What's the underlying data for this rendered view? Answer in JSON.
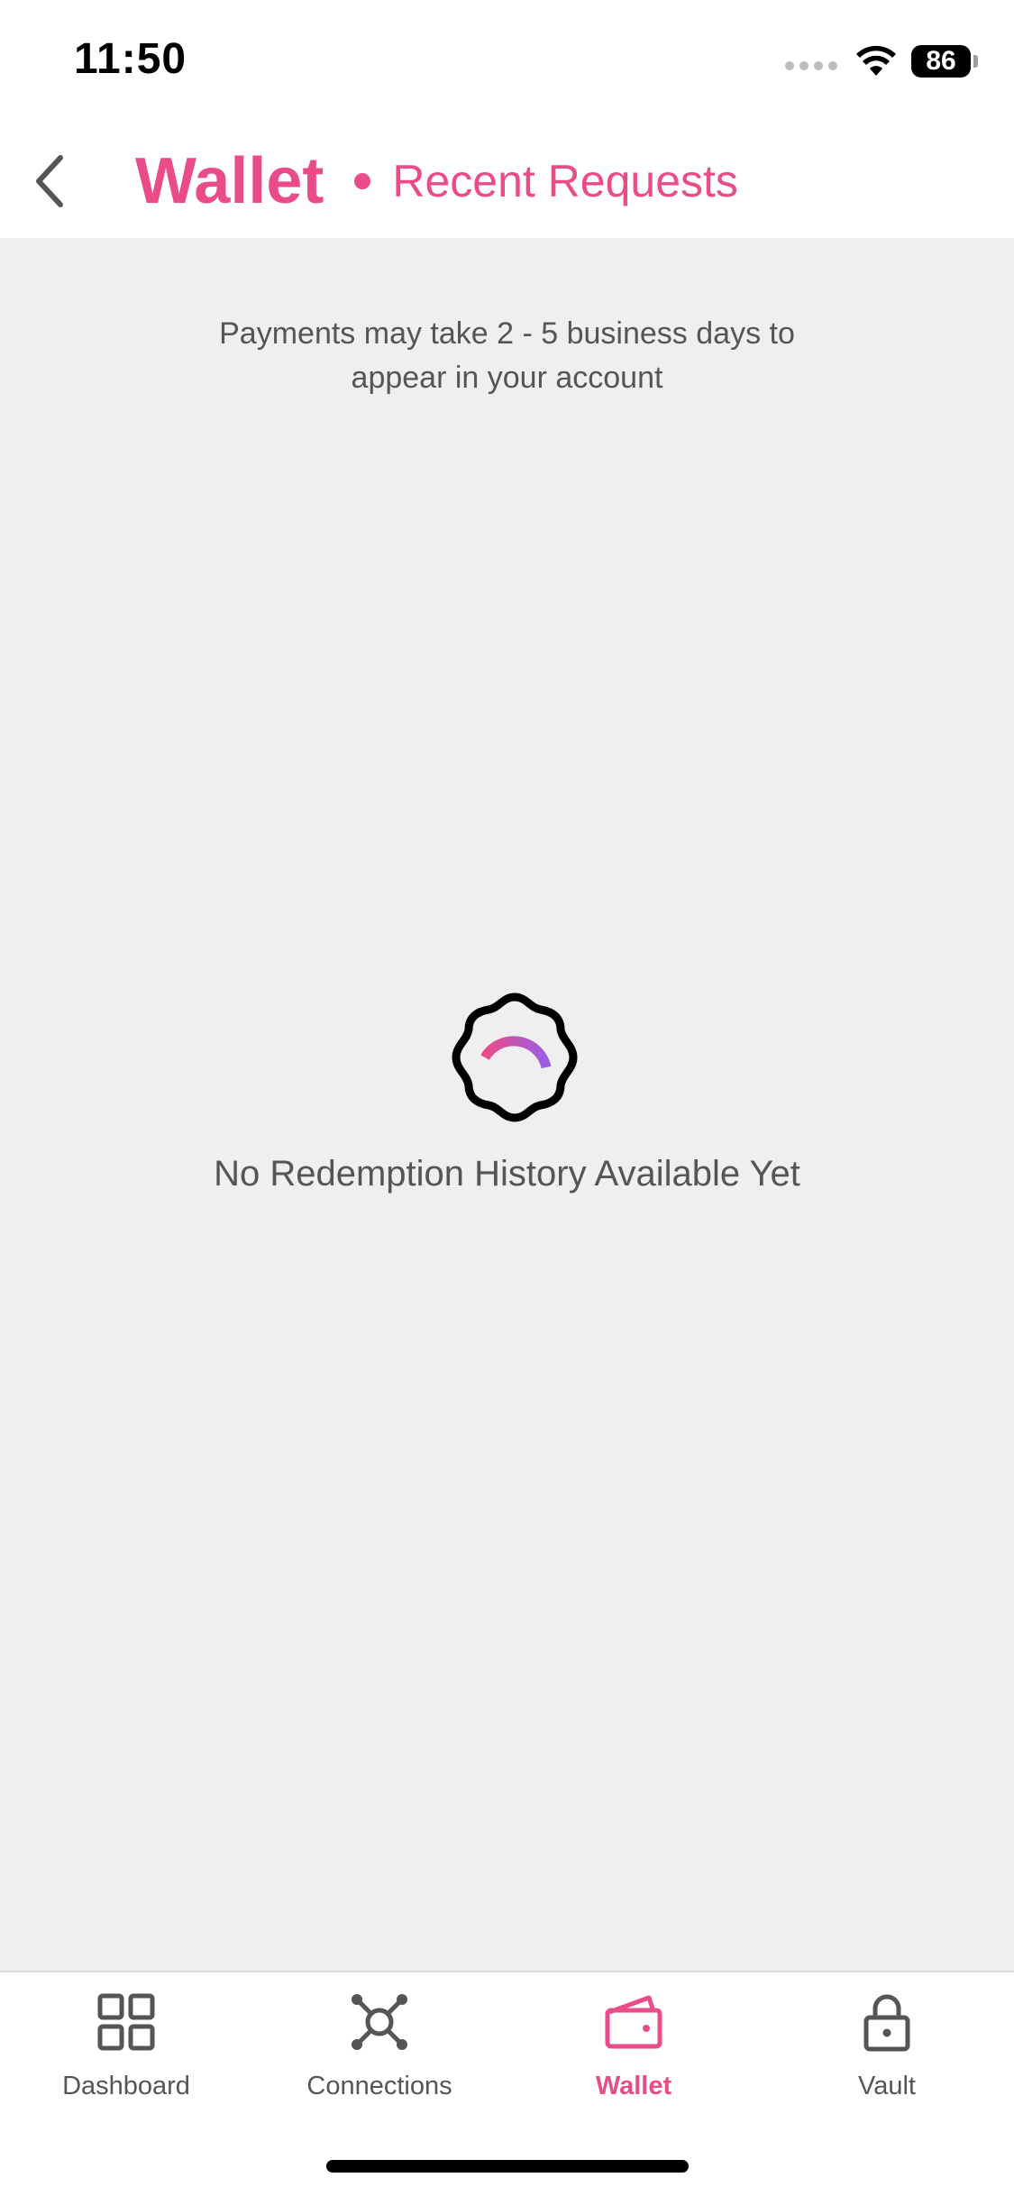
{
  "status_bar": {
    "time": "11:50",
    "battery": "86",
    "icons": [
      "cellular-icon",
      "wifi-icon",
      "battery-icon"
    ]
  },
  "header": {
    "back_icon": "chevron-left-icon",
    "title": "Wallet",
    "subtitle": "Recent Requests"
  },
  "notice": {
    "line1": "Payments may take 2 - 5 business days to",
    "line2": "appear in your account"
  },
  "empty_state": {
    "icon": "badge-loading-icon",
    "message": "No Redemption History Available Yet"
  },
  "bottom_nav": {
    "items": [
      {
        "label": "Dashboard",
        "icon": "grid-icon",
        "active": false
      },
      {
        "label": "Connections",
        "icon": "connections-icon",
        "active": false
      },
      {
        "label": "Wallet",
        "icon": "wallet-icon",
        "active": true
      },
      {
        "label": "Vault",
        "icon": "lock-icon",
        "active": false
      }
    ]
  },
  "colors": {
    "accent": "#ea4c89",
    "background": "#efefef",
    "text_secondary": "#555555",
    "spinner_gradient": [
      "#ea4c89",
      "#9b5de5"
    ]
  }
}
